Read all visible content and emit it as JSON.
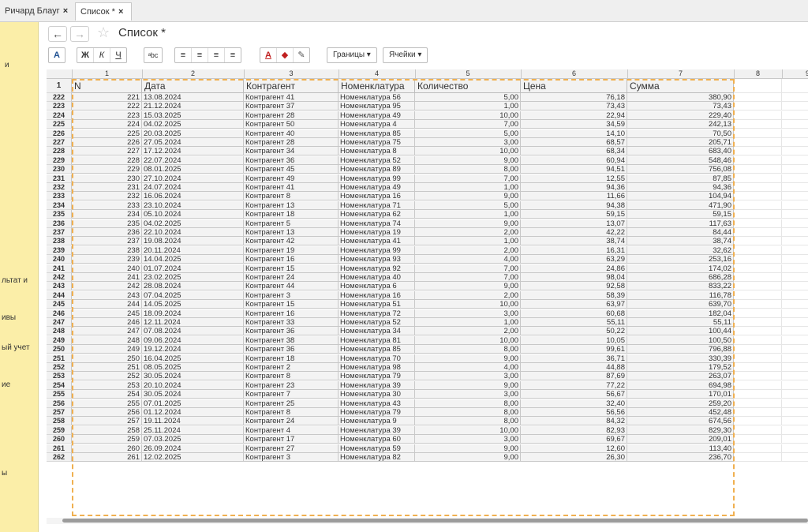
{
  "tabs": [
    {
      "label": "Ричард Блауг"
    },
    {
      "label": "Список *"
    }
  ],
  "close_glyph": "×",
  "sidebar": {
    "items": [
      "и",
      "льтат и",
      "ивы",
      "ый учет",
      "ие",
      "ы"
    ]
  },
  "header": {
    "title": "Список *",
    "back_glyph": "←",
    "forward_glyph": "→",
    "star_glyph": "☆"
  },
  "toolbar": {
    "fill_label": "A",
    "bold": "Ж",
    "italic": "К",
    "underline": "Ч",
    "format_label": "ᵃbc",
    "align": [
      "≡",
      "≡",
      "≡",
      "≡"
    ],
    "text_color": "A",
    "fill_color": "◆",
    "pen": "✎",
    "borders_label": "Границы ▾",
    "cells_label": "Ячейки ▾"
  },
  "columns": [
    "1",
    "2",
    "3",
    "4",
    "5",
    "6",
    "7",
    "8",
    "9"
  ],
  "header_row_number": "1",
  "headers": [
    "N",
    "Дата",
    "Контрагент",
    "Номенклатура",
    "Количество",
    "Цена",
    "Сумма"
  ],
  "rows": [
    [
      "222",
      "221",
      "13.08.2024",
      "Контрагент 41",
      "Номенклатура 56",
      "5,00",
      "76,18",
      "380,90"
    ],
    [
      "223",
      "222",
      "21.12.2024",
      "Контрагент 37",
      "Номенклатура 95",
      "1,00",
      "73,43",
      "73,43"
    ],
    [
      "224",
      "223",
      "15.03.2025",
      "Контрагент 28",
      "Номенклатура 49",
      "10,00",
      "22,94",
      "229,40"
    ],
    [
      "225",
      "224",
      "04.02.2025",
      "Контрагент 50",
      "Номенклатура 4",
      "7,00",
      "34,59",
      "242,13"
    ],
    [
      "226",
      "225",
      "20.03.2025",
      "Контрагент 40",
      "Номенклатура 85",
      "5,00",
      "14,10",
      "70,50"
    ],
    [
      "227",
      "226",
      "27.05.2024",
      "Контрагент 28",
      "Номенклатура 75",
      "3,00",
      "68,57",
      "205,71"
    ],
    [
      "228",
      "227",
      "17.12.2024",
      "Контрагент 34",
      "Номенклатура 8",
      "10,00",
      "68,34",
      "683,40"
    ],
    [
      "229",
      "228",
      "22.07.2024",
      "Контрагент 36",
      "Номенклатура 52",
      "9,00",
      "60,94",
      "548,46"
    ],
    [
      "230",
      "229",
      "08.01.2025",
      "Контрагент 45",
      "Номенклатура 89",
      "8,00",
      "94,51",
      "756,08"
    ],
    [
      "231",
      "230",
      "27.10.2024",
      "Контрагент 49",
      "Номенклатура 99",
      "7,00",
      "12,55",
      "87,85"
    ],
    [
      "232",
      "231",
      "24.07.2024",
      "Контрагент 41",
      "Номенклатура 49",
      "1,00",
      "94,36",
      "94,36"
    ],
    [
      "233",
      "232",
      "16.06.2024",
      "Контрагент 8",
      "Номенклатура 16",
      "9,00",
      "11,66",
      "104,94"
    ],
    [
      "234",
      "233",
      "23.10.2024",
      "Контрагент 13",
      "Номенклатура 71",
      "5,00",
      "94,38",
      "471,90"
    ],
    [
      "235",
      "234",
      "05.10.2024",
      "Контрагент 18",
      "Номенклатура 62",
      "1,00",
      "59,15",
      "59,15"
    ],
    [
      "236",
      "235",
      "04.02.2025",
      "Контрагент 5",
      "Номенклатура 74",
      "9,00",
      "13,07",
      "117,63"
    ],
    [
      "237",
      "236",
      "22.10.2024",
      "Контрагент 13",
      "Номенклатура 19",
      "2,00",
      "42,22",
      "84,44"
    ],
    [
      "238",
      "237",
      "19.08.2024",
      "Контрагент 42",
      "Номенклатура 41",
      "1,00",
      "38,74",
      "38,74"
    ],
    [
      "239",
      "238",
      "20.11.2024",
      "Контрагент 19",
      "Номенклатура 99",
      "2,00",
      "16,31",
      "32,62"
    ],
    [
      "240",
      "239",
      "14.04.2025",
      "Контрагент 16",
      "Номенклатура 93",
      "4,00",
      "63,29",
      "253,16"
    ],
    [
      "241",
      "240",
      "01.07.2024",
      "Контрагент 15",
      "Номенклатура 92",
      "7,00",
      "24,86",
      "174,02"
    ],
    [
      "242",
      "241",
      "23.02.2025",
      "Контрагент 24",
      "Номенклатура 40",
      "7,00",
      "98,04",
      "686,28"
    ],
    [
      "243",
      "242",
      "28.08.2024",
      "Контрагент 44",
      "Номенклатура 6",
      "9,00",
      "92,58",
      "833,22"
    ],
    [
      "244",
      "243",
      "07.04.2025",
      "Контрагент 3",
      "Номенклатура 16",
      "2,00",
      "58,39",
      "116,78"
    ],
    [
      "245",
      "244",
      "14.05.2025",
      "Контрагент 15",
      "Номенклатура 51",
      "10,00",
      "63,97",
      "639,70"
    ],
    [
      "246",
      "245",
      "18.09.2024",
      "Контрагент 16",
      "Номенклатура 72",
      "3,00",
      "60,68",
      "182,04"
    ],
    [
      "247",
      "246",
      "12.11.2024",
      "Контрагент 33",
      "Номенклатура 52",
      "1,00",
      "55,11",
      "55,11"
    ],
    [
      "248",
      "247",
      "07.08.2024",
      "Контрагент 36",
      "Номенклатура 34",
      "2,00",
      "50,22",
      "100,44"
    ],
    [
      "249",
      "248",
      "09.06.2024",
      "Контрагент 38",
      "Номенклатура 81",
      "10,00",
      "10,05",
      "100,50"
    ],
    [
      "250",
      "249",
      "19.12.2024",
      "Контрагент 36",
      "Номенклатура 85",
      "8,00",
      "99,61",
      "796,88"
    ],
    [
      "251",
      "250",
      "16.04.2025",
      "Контрагент 18",
      "Номенклатура 70",
      "9,00",
      "36,71",
      "330,39"
    ],
    [
      "252",
      "251",
      "08.05.2025",
      "Контрагент 2",
      "Номенклатура 98",
      "4,00",
      "44,88",
      "179,52"
    ],
    [
      "253",
      "252",
      "30.05.2024",
      "Контрагент 8",
      "Номенклатура 79",
      "3,00",
      "87,69",
      "263,07"
    ],
    [
      "254",
      "253",
      "20.10.2024",
      "Контрагент 23",
      "Номенклатура 39",
      "9,00",
      "77,22",
      "694,98"
    ],
    [
      "255",
      "254",
      "30.05.2024",
      "Контрагент 7",
      "Номенклатура 30",
      "3,00",
      "56,67",
      "170,01"
    ],
    [
      "256",
      "255",
      "07.01.2025",
      "Контрагент 25",
      "Номенклатура 43",
      "8,00",
      "32,40",
      "259,20"
    ],
    [
      "257",
      "256",
      "01.12.2024",
      "Контрагент 8",
      "Номенклатура 79",
      "8,00",
      "56,56",
      "452,48"
    ],
    [
      "258",
      "257",
      "19.11.2024",
      "Контрагент 24",
      "Номенклатура 9",
      "8,00",
      "84,32",
      "674,56"
    ],
    [
      "259",
      "258",
      "25.11.2024",
      "Контрагент 4",
      "Номенклатура 39",
      "10,00",
      "82,93",
      "829,30"
    ],
    [
      "260",
      "259",
      "07.03.2025",
      "Контрагент 17",
      "Номенклатура 60",
      "3,00",
      "69,67",
      "209,01"
    ],
    [
      "261",
      "260",
      "26.09.2024",
      "Контрагент 27",
      "Номенклатура 59",
      "9,00",
      "12,60",
      "113,40"
    ],
    [
      "262",
      "261",
      "12.02.2025",
      "Контрагент 3",
      "Номенклатура 82",
      "9,00",
      "26,30",
      "236,70"
    ]
  ]
}
